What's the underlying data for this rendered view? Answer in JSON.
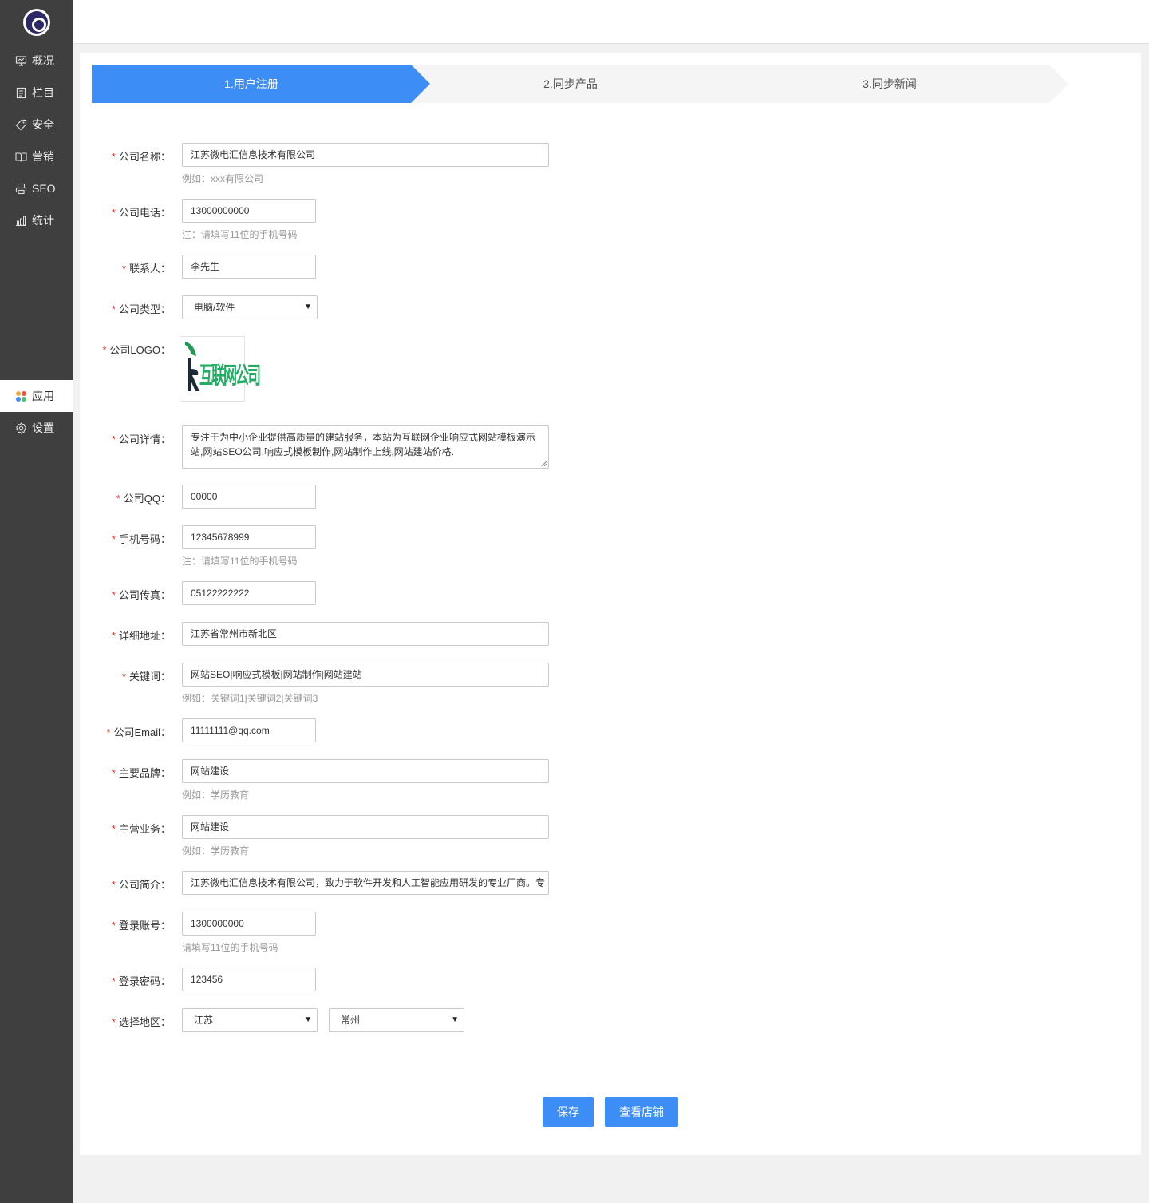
{
  "sidebar": {
    "items": [
      {
        "label": "概况",
        "icon": "monitor-icon"
      },
      {
        "label": "栏目",
        "icon": "document-icon"
      },
      {
        "label": "安全",
        "icon": "tag-icon"
      },
      {
        "label": "营销",
        "icon": "book-icon"
      },
      {
        "label": "SEO",
        "icon": "print-icon"
      },
      {
        "label": "统计",
        "icon": "bar-chart-icon"
      },
      {
        "label": "应用",
        "icon": "apps-icon"
      },
      {
        "label": "设置",
        "icon": "gear-icon"
      }
    ],
    "active_index": 6
  },
  "steps": [
    {
      "label": "1.用户注册",
      "active": true
    },
    {
      "label": "2.同步产品",
      "active": false
    },
    {
      "label": "3.同步新闻",
      "active": false
    }
  ],
  "form": {
    "required_mark": "*",
    "company_name": {
      "label": "公司名称：",
      "value": "江苏微电汇信息技术有限公司",
      "hint": "例如：xxx有限公司"
    },
    "company_phone": {
      "label": "公司电话：",
      "value": "13000000000",
      "hint": "注：请填写11位的手机号码"
    },
    "contact": {
      "label": "联系人：",
      "value": "李先生"
    },
    "company_type": {
      "label": "公司类型：",
      "value": "电脑/软件"
    },
    "company_logo": {
      "label": "公司LOGO：",
      "logo_text": "互联网公司"
    },
    "company_detail": {
      "label": "公司详情：",
      "value": "专注于为中小企业提供高质量的建站服务，本站为互联网企业响应式网站模板演示站,网站SEO公司,响应式模板制作,网站制作上线,网站建站价格."
    },
    "company_qq": {
      "label": "公司QQ：",
      "value": "00000"
    },
    "mobile": {
      "label": "手机号码：",
      "value": "12345678999",
      "hint": "注：请填写11位的手机号码"
    },
    "fax": {
      "label": "公司传真：",
      "value": "05122222222"
    },
    "address": {
      "label": "详细地址：",
      "value": "江苏省常州市新北区"
    },
    "keywords": {
      "label": "关键词：",
      "value": "网站SEO|响应式模板|网站制作|网站建站",
      "hint": "例如：关键词1|关键词2|关键词3"
    },
    "email": {
      "label": "公司Email：",
      "value": "11111111@qq.com"
    },
    "brand": {
      "label": "主要品牌：",
      "value": "网站建设",
      "hint": "例如：学历教育"
    },
    "business": {
      "label": "主营业务：",
      "value": "网站建设",
      "hint": "例如：学历教育"
    },
    "intro": {
      "label": "公司简介：",
      "value": "江苏微电汇信息技术有限公司，致力于软件开发和人工智能应用研发的专业厂商。专"
    },
    "account": {
      "label": "登录账号：",
      "value": "1300000000",
      "hint": "请填写11位的手机号码"
    },
    "password": {
      "label": "登录密码：",
      "value": "123456"
    },
    "region": {
      "label": "选择地区：",
      "province": "江苏",
      "city": "常州"
    }
  },
  "buttons": {
    "save": "保存",
    "view_store": "查看店铺"
  },
  "colors": {
    "primary": "#3d8df7",
    "sidebar_bg": "#3f3f3f",
    "required": "#e53333",
    "step_inactive": "#f5f5f5"
  }
}
